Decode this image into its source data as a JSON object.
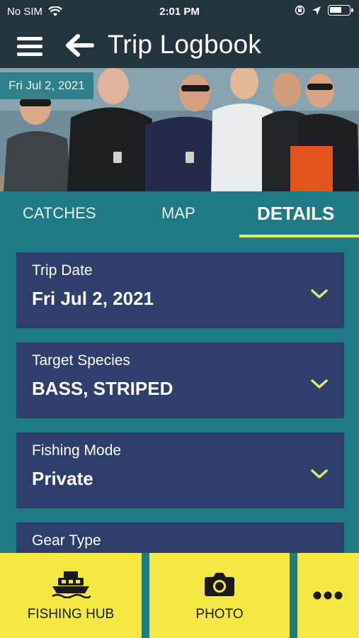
{
  "status_bar": {
    "carrier": "No SIM",
    "time": "2:01 PM",
    "battery_level": 0.6
  },
  "header": {
    "title": "Trip Logbook",
    "menu_icon": "hamburger-menu-icon",
    "back_icon": "arrow-left-icon"
  },
  "hero": {
    "date_badge": "Fri Jul 2, 2021"
  },
  "tabs": [
    {
      "label": "CATCHES",
      "active": false
    },
    {
      "label": "MAP",
      "active": false
    },
    {
      "label": "DETAILS",
      "active": true
    }
  ],
  "details": [
    {
      "label": "Trip Date",
      "value": "Fri Jul 2, 2021"
    },
    {
      "label": "Target Species",
      "value": "BASS, STRIPED"
    },
    {
      "label": "Fishing Mode",
      "value": "Private"
    },
    {
      "label": "Gear Type",
      "value": ""
    }
  ],
  "bottom_bar": {
    "fishing_hub_label": "FISHING HUB",
    "photo_label": "PHOTO",
    "more_icon": "more-dots-icon"
  },
  "colors": {
    "header_bg": "#24343f",
    "teal": "#1e7a84",
    "card_bg": "#2e3f6e",
    "accent_yellow": "#f4e842",
    "chevron": "#dfe96a"
  }
}
